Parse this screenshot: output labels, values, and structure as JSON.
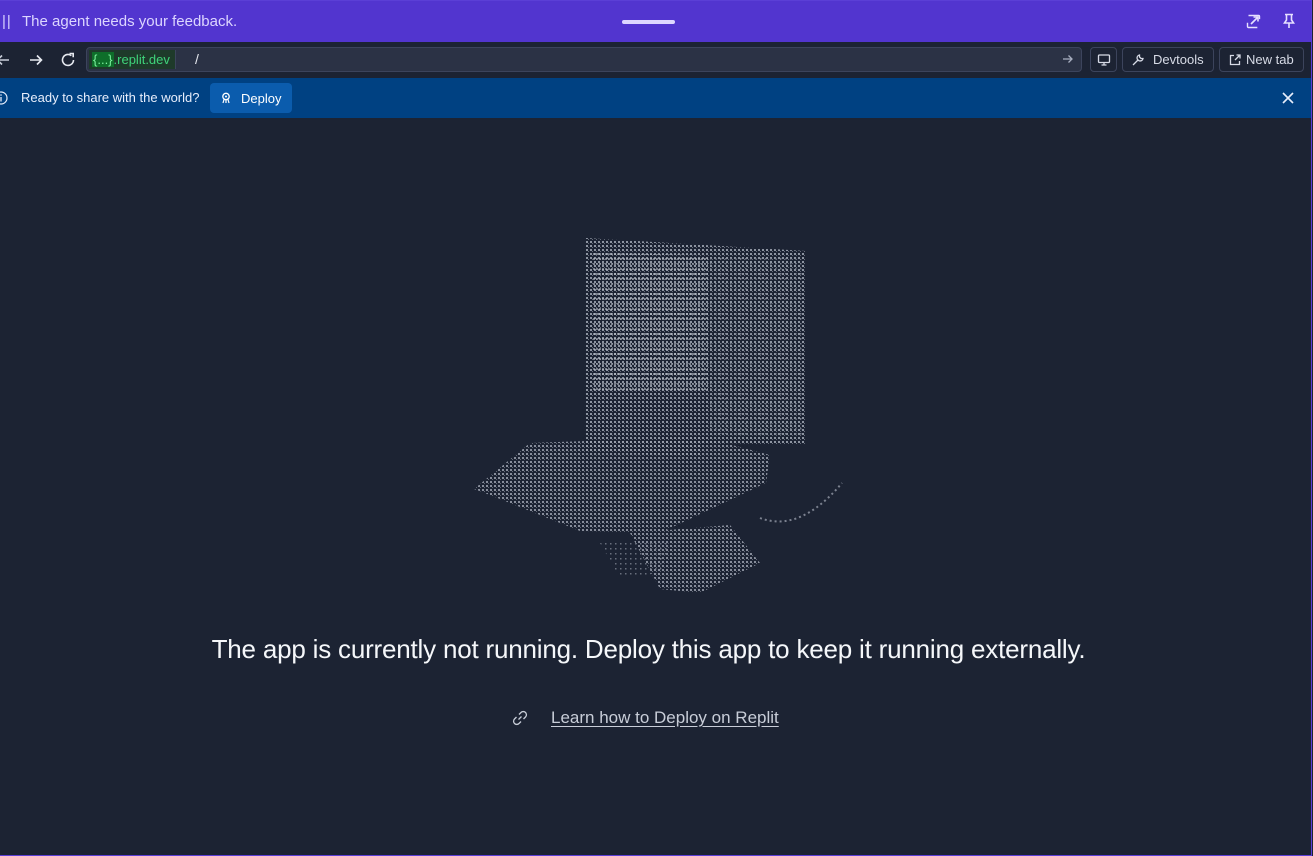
{
  "feedback_bar": {
    "message": "The agent needs your feedback.",
    "pause_glyph": "||"
  },
  "nav": {
    "url_host_placeholder": "{...}",
    "url_host_domain": ".replit.dev",
    "url_path": "/",
    "devtools_label": "Devtools",
    "new_tab_label": "New tab"
  },
  "banner": {
    "text": "Ready to share with the world?",
    "deploy_label": "Deploy"
  },
  "main": {
    "headline": "The app is currently not running. Deploy this app to keep it running externally.",
    "learn_link": "Learn how to Deploy on Replit"
  },
  "colors": {
    "feedback_bar": "#5235cf",
    "banner": "#004182",
    "background": "#1c2333",
    "deploy_button": "#0b5cad"
  },
  "icons": [
    "pause-icon",
    "popout-icon",
    "pin-icon",
    "back-icon",
    "forward-icon",
    "reload-icon",
    "go-icon",
    "screen-icon",
    "wrench-icon",
    "external-link-icon",
    "info-icon",
    "deploy-icon",
    "close-icon",
    "link-icon"
  ]
}
